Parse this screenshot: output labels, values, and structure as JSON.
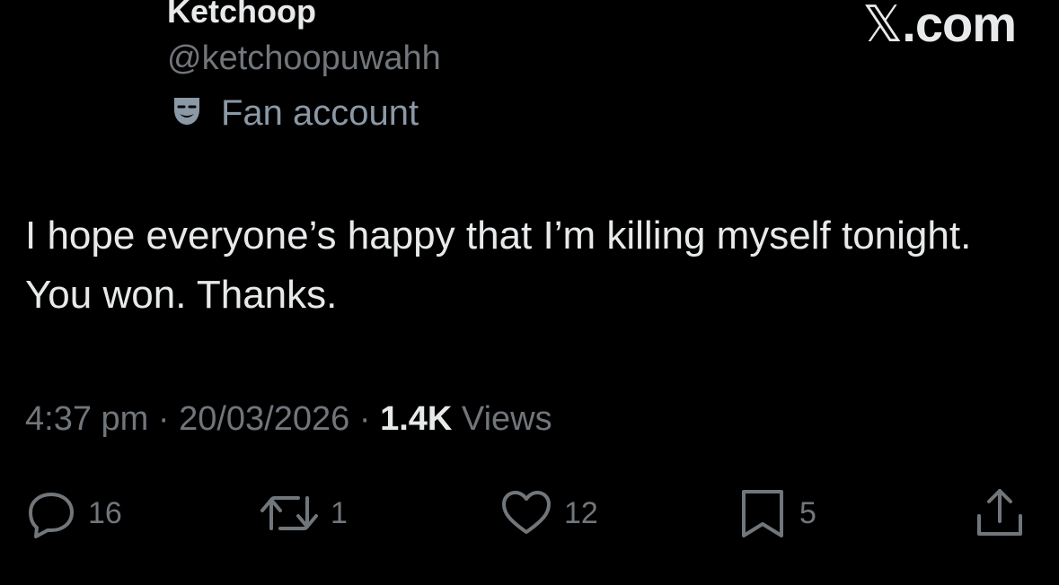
{
  "author": {
    "display_name": "Ketchoop",
    "handle": "@ketchoopuwahh",
    "label": "Fan account",
    "label_icon": "theater-masks-icon"
  },
  "brand": {
    "x_glyph": "𝕏",
    "suffix": ".com"
  },
  "post": {
    "text": "I hope everyone’s happy that I’m killing myself tonight. You won. Thanks."
  },
  "meta": {
    "time": "4:37 pm",
    "separator": "·",
    "date": "20/03/2026",
    "views_count": "1.4K",
    "views_label": "Views"
  },
  "actions": {
    "replies": {
      "icon": "reply-icon",
      "count": "16"
    },
    "reposts": {
      "icon": "repost-icon",
      "count": "1"
    },
    "likes": {
      "icon": "heart-icon",
      "count": "12"
    },
    "bookmarks": {
      "icon": "bookmark-icon",
      "count": "5"
    },
    "share": {
      "icon": "share-icon"
    }
  },
  "colors": {
    "background": "#000000",
    "primary_text": "#e7e9ea",
    "secondary_text": "#71767b",
    "label_icon": "#8b98a5"
  }
}
